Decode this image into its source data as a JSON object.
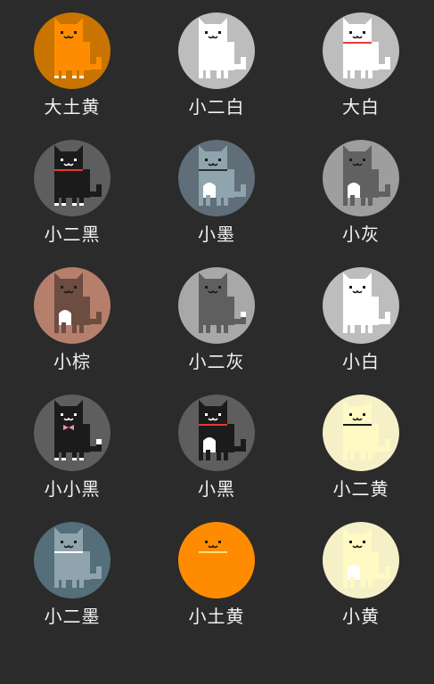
{
  "cats": [
    {
      "name": "大土黄",
      "bg": "#c97300",
      "body": "#ff8c00",
      "belly": null,
      "collar": null,
      "paws": "#ffffff",
      "tail_tip": null,
      "face": "#1a1a1a",
      "bow": null
    },
    {
      "name": "小二白",
      "bg": "#bdbdbd",
      "body": "#ffffff",
      "belly": null,
      "collar": null,
      "paws": null,
      "tail_tip": null,
      "face": "#1a1a1a",
      "bow": null
    },
    {
      "name": "大白",
      "bg": "#bdbdbd",
      "body": "#ffffff",
      "belly": null,
      "collar": "#e53935",
      "paws": null,
      "tail_tip": null,
      "face": "#1a1a1a",
      "bow": null
    },
    {
      "name": "小二黑",
      "bg": "#5e5e5e",
      "body": "#1b1b1b",
      "belly": null,
      "collar": "#e53935",
      "paws": "#ffffff",
      "tail_tip": null,
      "face": "#ffffff",
      "bow": null
    },
    {
      "name": "小墨",
      "bg": "#5f6e78",
      "body": "#90a4ae",
      "belly": "#ffffff",
      "collar": "#263238",
      "paws": null,
      "tail_tip": null,
      "face": "#1a1a1a",
      "bow": null
    },
    {
      "name": "小灰",
      "bg": "#9e9e9e",
      "body": "#616161",
      "belly": "#ffffff",
      "collar": null,
      "paws": null,
      "tail_tip": null,
      "face": "#1a1a1a",
      "bow": null
    },
    {
      "name": "小棕",
      "bg": "#b57f6c",
      "body": "#6d4c41",
      "belly": "#ffffff",
      "collar": null,
      "paws": null,
      "tail_tip": null,
      "face": "#1a1a1a",
      "bow": null
    },
    {
      "name": "小二灰",
      "bg": "#a8a8a8",
      "body": "#5f5f5f",
      "belly": null,
      "collar": null,
      "paws": null,
      "tail_tip": "#ffffff",
      "face": "#1a1a1a",
      "bow": null
    },
    {
      "name": "小白",
      "bg": "#bdbdbd",
      "body": "#ffffff",
      "belly": null,
      "collar": null,
      "paws": null,
      "tail_tip": null,
      "face": "#1a1a1a",
      "bow": null
    },
    {
      "name": "小小黑",
      "bg": "#5e5e5e",
      "body": "#1b1b1b",
      "belly": null,
      "collar": null,
      "paws": "#ffffff",
      "tail_tip": "#ffffff",
      "face": "#ffffff",
      "bow": "#f48fb1"
    },
    {
      "name": "小黑",
      "bg": "#5e5e5e",
      "body": "#1b1b1b",
      "belly": "#ffffff",
      "collar": "#e53935",
      "paws": null,
      "tail_tip": null,
      "face": "#ffffff",
      "bow": null
    },
    {
      "name": "小二黄",
      "bg": "#f5f0c8",
      "body": "#fff9c4",
      "belly": null,
      "collar": "#1a1a1a",
      "paws": null,
      "tail_tip": null,
      "face": "#1a1a1a",
      "bow": null
    },
    {
      "name": "小二墨",
      "bg": "#546e7a",
      "body": "#90a4ae",
      "belly": null,
      "collar": "#ffffff",
      "paws": null,
      "tail_tip": null,
      "face": "#1a1a1a",
      "bow": null
    },
    {
      "name": "小土黄",
      "bg": "#ff8c00",
      "body": "#ff8c00",
      "belly": null,
      "collar": "#ffe082",
      "paws": null,
      "tail_tip": null,
      "face": "#1a1a1a",
      "bow": null
    },
    {
      "name": "小黄",
      "bg": "#f5f0c8",
      "body": "#fff9c4",
      "belly": "#ffffff",
      "collar": null,
      "paws": null,
      "tail_tip": null,
      "face": "#1a1a1a",
      "bow": null
    }
  ]
}
